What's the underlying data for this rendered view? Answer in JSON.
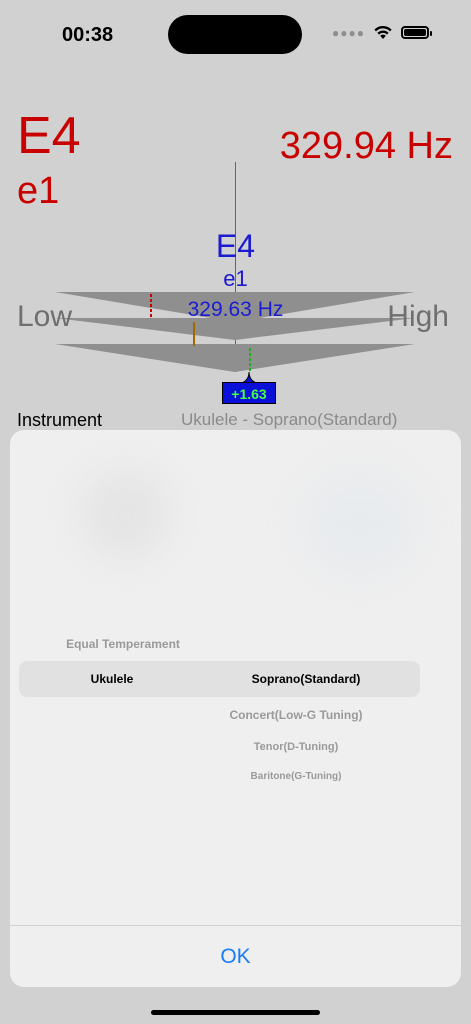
{
  "status_bar": {
    "time": "00:38",
    "icons": [
      "cellular-dots-icon",
      "wifi-icon",
      "battery-icon"
    ]
  },
  "detected": {
    "note": "E4",
    "octave_note": "e1",
    "frequency": "329.94 Hz"
  },
  "target": {
    "note": "E4",
    "octave_note": "e1",
    "frequency": "329.63 Hz"
  },
  "gauge": {
    "low_label": "Low",
    "high_label": "High",
    "cents": "+1.63"
  },
  "instrument": {
    "label": "Instrument",
    "value": "Ukulele - Soprano(Standard)"
  },
  "picker": {
    "temperament": "Equal Temperament",
    "selected_instrument": "Ukulele",
    "selected_tuning": "Soprano(Standard)",
    "tunings": [
      "Concert(Low-G Tuning)",
      "Tenor(D-Tuning)",
      "Baritone(G-Tuning)"
    ]
  },
  "ok_label": "OK",
  "colors": {
    "detected": "#c90000",
    "target": "#1b1bd1",
    "accent": "#1a7cf0",
    "cents_badge": "#0a10d8",
    "cents_text": "#46ff46"
  }
}
